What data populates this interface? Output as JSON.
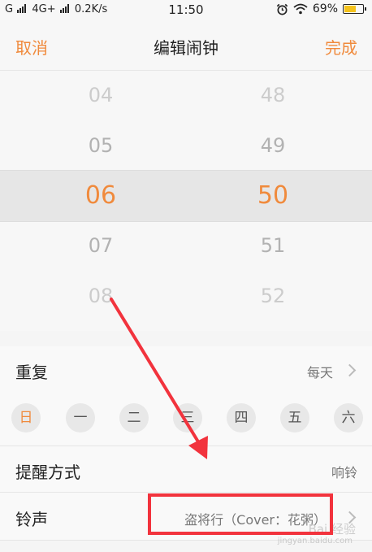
{
  "status_bar": {
    "left_text": "G",
    "network": "4G+",
    "speed": "0.2K/s",
    "time": "11:50",
    "battery": "69%",
    "battery_level": 0.69
  },
  "header": {
    "cancel": "取消",
    "title": "编辑闹钟",
    "done": "完成"
  },
  "picker": {
    "hours": [
      "04",
      "05",
      "06",
      "07",
      "08"
    ],
    "minutes": [
      "48",
      "49",
      "50",
      "51",
      "52"
    ],
    "selected_index": 2
  },
  "repeat": {
    "label": "重复",
    "value": "每天"
  },
  "days": [
    {
      "label": "日",
      "active": true
    },
    {
      "label": "一",
      "active": false
    },
    {
      "label": "二",
      "active": false
    },
    {
      "label": "三",
      "active": false
    },
    {
      "label": "四",
      "active": false
    },
    {
      "label": "五",
      "active": false
    },
    {
      "label": "六",
      "active": false
    }
  ],
  "reminder": {
    "label": "提醒方式",
    "value": "响铃"
  },
  "ringtone": {
    "label": "铃声",
    "value": "盗将行（Cover：花粥）"
  },
  "watermark": {
    "text": "Bai 经验",
    "sub": "jingyan.baidu.com"
  },
  "colors": {
    "accent": "#f08a3c",
    "annotation": "#f2333d"
  }
}
